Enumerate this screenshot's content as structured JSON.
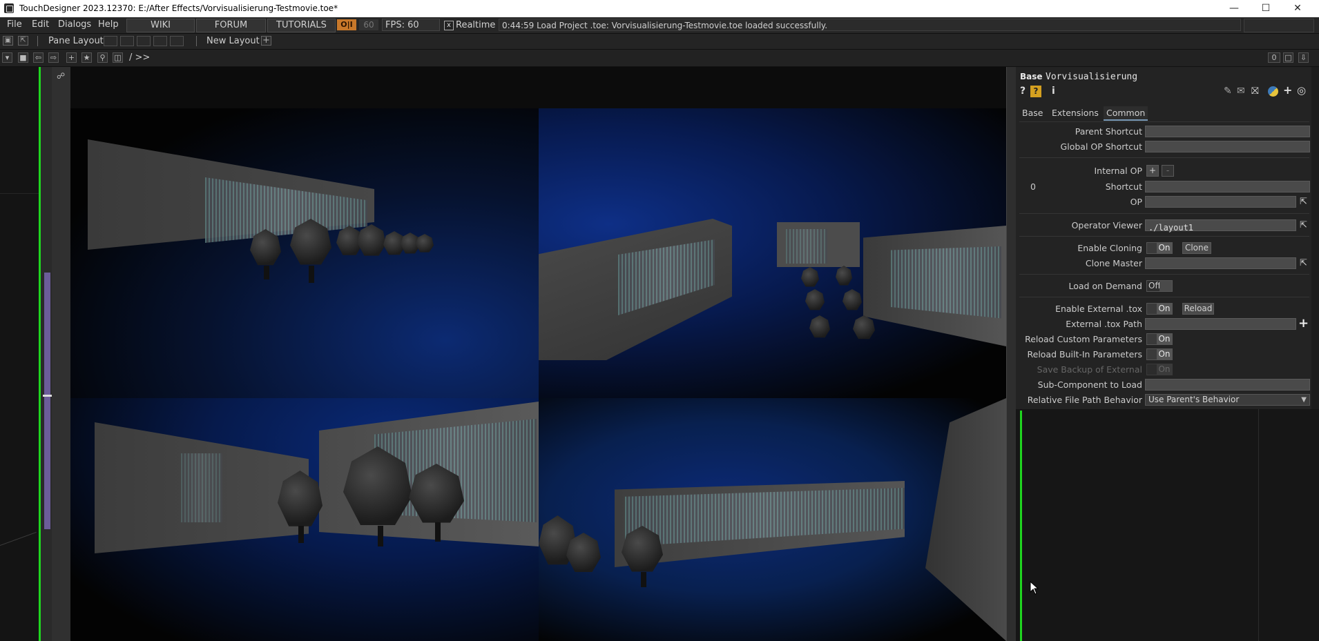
{
  "window": {
    "title": "TouchDesigner 2023.12370: E:/After Effects/Vorvisualisierung-Testmovie.toe*",
    "minimize": "—",
    "maximize": "☐",
    "close": "✕"
  },
  "menubar": {
    "menus": [
      "File",
      "Edit",
      "Dialogs",
      "Help"
    ],
    "wiki": "WIKI",
    "forum": "FORUM",
    "tutorials": "TUTORIALS",
    "oii": "O|I",
    "cook_rate": "60",
    "fps": "FPS:  60",
    "realtime_check": "x",
    "realtime": "Realtime",
    "status": "0:44:59 Load Project .toe: Vorvisualisierung-Testmovie.toe loaded successfully."
  },
  "panebar": {
    "pane_layout": "Pane Layout",
    "new_layout": "New Layout",
    "add": "+"
  },
  "pathbar": {
    "path": "/ >>",
    "index": "0"
  },
  "param_panel": {
    "op_type": "Base",
    "op_name": "Vorvisualisierung",
    "tabs": [
      "Base",
      "Extensions",
      "Common"
    ],
    "active_tab": "Common",
    "params": {
      "parent_shortcut": "Parent Shortcut",
      "global_op_shortcut": "Global OP Shortcut",
      "internal_op": "Internal OP",
      "internal_op_plus": "+",
      "internal_op_minus": "-",
      "internal_index": "0",
      "shortcut": "Shortcut",
      "op": "OP",
      "operator_viewer": "Operator Viewer",
      "operator_viewer_value": "./layout1",
      "enable_cloning": "Enable Cloning",
      "enable_cloning_value": "On",
      "clone_button": "Clone",
      "clone_master": "Clone Master",
      "load_on_demand": "Load on Demand",
      "load_on_demand_value": "Off",
      "enable_external_tox": "Enable External .tox",
      "enable_external_tox_value": "On",
      "reload_button": "Reload",
      "external_tox_path": "External .tox Path",
      "reload_custom": "Reload Custom Parameters",
      "reload_custom_value": "On",
      "reload_builtin": "Reload Built-In Parameters",
      "reload_builtin_value": "On",
      "save_backup": "Save Backup of External",
      "save_backup_value": "On",
      "sub_component": "Sub-Component to Load",
      "relative_path": "Relative File Path Behavior",
      "relative_path_value": "Use Parent's Behavior"
    }
  }
}
